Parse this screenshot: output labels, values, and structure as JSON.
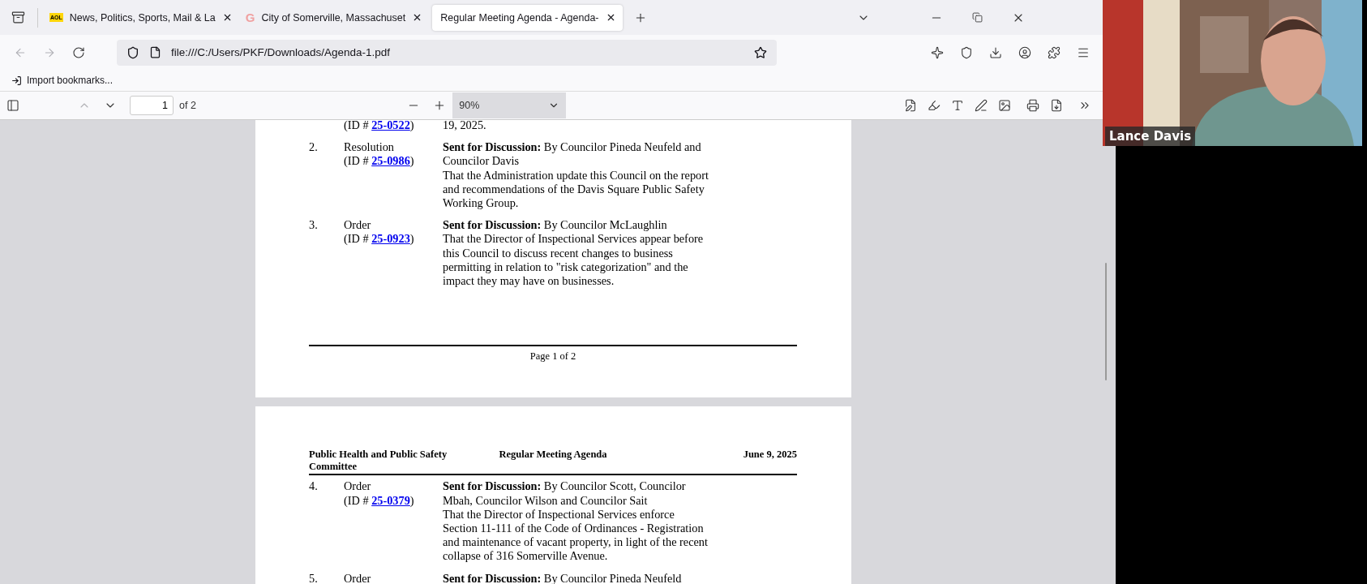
{
  "browser": {
    "tabs": [
      {
        "title": "News, Politics, Sports, Mail & La",
        "kind": "badge",
        "icon_text": "AOL",
        "selected": false
      },
      {
        "title": "City of Somerville, Massachuset",
        "kind": "letter",
        "icon_text": "G",
        "selected": false
      },
      {
        "title": "Regular Meeting Agenda - Agenda-",
        "kind": "plain",
        "selected": true
      }
    ],
    "address": "file:///C:/Users/PKF/Downloads/Agenda-1.pdf",
    "bookmarks": [
      "Import bookmarks..."
    ]
  },
  "pdf_toolbar": {
    "page_number": "1",
    "page_count": "of 2",
    "zoom": "90%"
  },
  "pages": [
    {
      "items": [
        {
          "id_prefix": "(ID # ",
          "id": "25-0522",
          "id_suffix": ")",
          "description": [
            "19, 2025."
          ]
        },
        {
          "number": "2.",
          "type": "Resolution",
          "id_prefix": "(ID # ",
          "id": "25-0986",
          "id_suffix": ")",
          "description": [
            "**Sent for Discussion:** By Councilor Pineda Neufeld and",
            "Councilor Davis",
            "That the Administration update this Council on the report",
            "and recommendations of the Davis Square Public Safety",
            "Working Group."
          ]
        },
        {
          "number": "3.",
          "type": "Order",
          "id_prefix": "(ID # ",
          "id": "25-0923",
          "id_suffix": ")",
          "description": [
            "**Sent for Discussion:** By Councilor McLaughlin",
            "That the Director of Inspectional Services appear before",
            "this Council to discuss recent changes to business",
            "permitting in relation to \"risk categorization\" and the",
            "impact they may have on businesses."
          ]
        }
      ],
      "footer": "Page 1 of 2"
    },
    {
      "header": {
        "left": "Public Health and Public Safety Committee",
        "center": "Regular Meeting Agenda",
        "right": "June 9, 2025"
      },
      "items": [
        {
          "number": "4.",
          "type": "Order",
          "id_prefix": "(ID # ",
          "id": "25-0379",
          "id_suffix": ")",
          "description": [
            "**Sent for Discussion:** By Councilor Scott, Councilor",
            "Mbah, Councilor Wilson and Councilor Sait",
            "That the Director of Inspectional Services enforce",
            "Section 11-111 of the Code of Ordinances - Registration",
            "and maintenance of vacant property, in light of the recent",
            "collapse of 316 Somerville Avenue."
          ]
        },
        {
          "number": "5.",
          "type": "Order",
          "description": [
            "**Sent for Discussion:** By Councilor Pineda Neufeld"
          ]
        }
      ]
    }
  ],
  "video": {
    "kind": "picture",
    "name": "Lance Davis"
  }
}
